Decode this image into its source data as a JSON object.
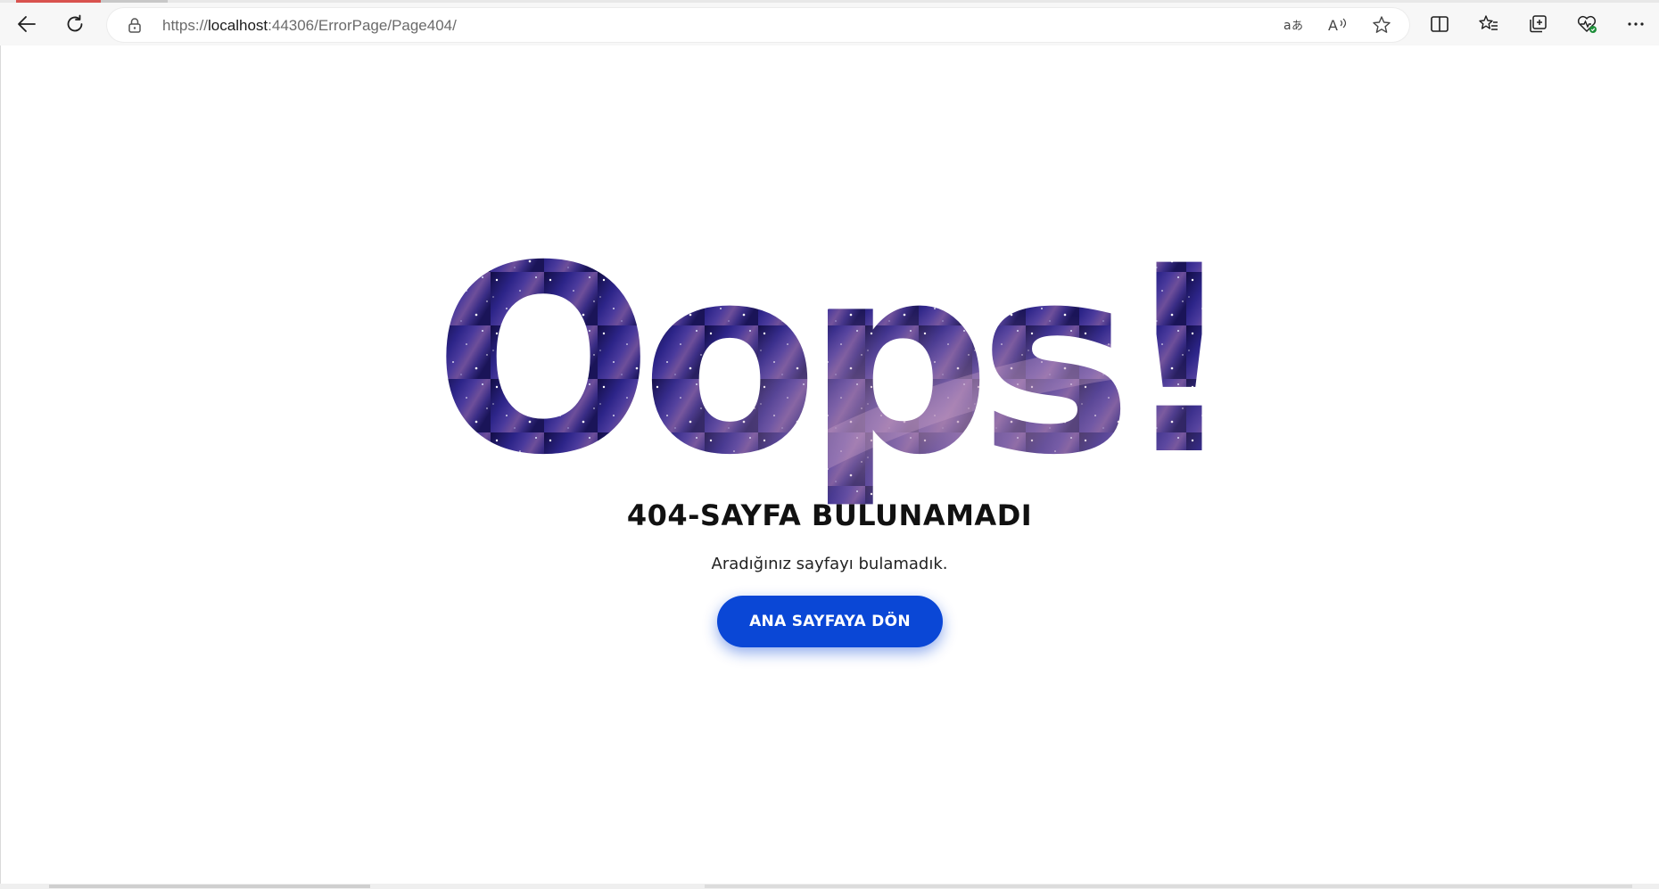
{
  "browser": {
    "url_scheme": "https://",
    "url_host": "localhost",
    "url_rest": ":44306/ErrorPage/Page404/",
    "icons": {
      "back": "back-arrow-icon",
      "refresh": "refresh-icon",
      "lock": "lock-icon",
      "translate": "translate-icon",
      "read_aloud": "read-aloud-icon",
      "favorite": "star-icon",
      "split_screen": "split-screen-icon",
      "favorites": "favorites-list-icon",
      "collections": "collections-icon",
      "health": "browser-essentials-icon",
      "more": "more-icon"
    }
  },
  "page": {
    "hero_text": "Oops!",
    "heading": "404-SAYFA BULUNAMADI",
    "subtitle": "Aradığınız sayfayı bulamadık.",
    "home_button": "ANA SAYFAYA DÖN",
    "colors": {
      "button": "#0a47d6",
      "galaxy_dark": "#1a1458",
      "galaxy_mid": "#3c2f8f",
      "galaxy_light": "#8a6fb0"
    }
  }
}
